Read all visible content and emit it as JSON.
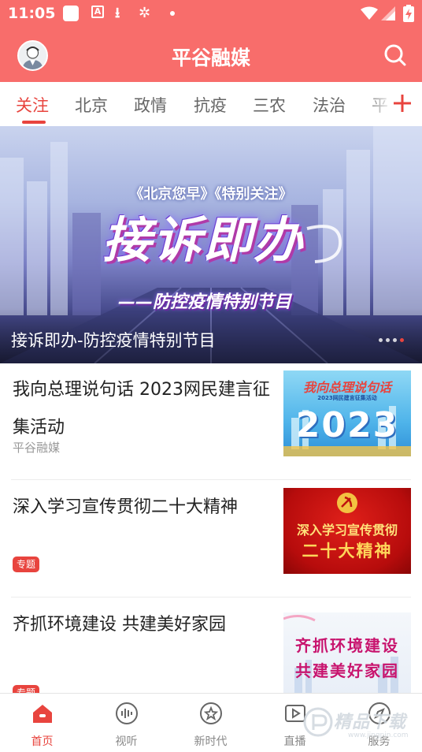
{
  "status_bar": {
    "time": "11:05",
    "icons": [
      "notification-square-icon",
      "a-box-icon",
      "download-icon",
      "bug-icon",
      "dot-icon",
      "wifi-icon",
      "signal-icon",
      "battery-icon"
    ]
  },
  "header": {
    "title": "平谷融媒",
    "brand_color": "#f86d6b"
  },
  "tabs": {
    "items": [
      {
        "label": "关注",
        "active": true
      },
      {
        "label": "北京"
      },
      {
        "label": "政情"
      },
      {
        "label": "抗疫"
      },
      {
        "label": "三农"
      },
      {
        "label": "法治"
      },
      {
        "label": "平"
      }
    ],
    "accent_color": "#e8443e"
  },
  "banner": {
    "image_subtitle": "《北京您早》《特别关注》",
    "image_title": "接诉即办",
    "image_line": "——防控疫情特别节目",
    "caption": "接诉即办-防控疫情特别节目",
    "slide_count": 4,
    "active_slide": 4
  },
  "news": [
    {
      "title": "我向总理说句话 2023网民建言征集活动",
      "source": "平谷融媒",
      "thumb": {
        "line1": "我向总理说句话",
        "line2": "2023网民建言征集活动",
        "big": "2023"
      }
    },
    {
      "title": "深入学习宣传贯彻二十大精神",
      "tag": "专题",
      "thumb": {
        "line1": "深入学习宣传贯彻",
        "line2": "二十大精神"
      }
    },
    {
      "title": "齐抓环境建设 共建美好家园",
      "tag": "专题",
      "thumb": {
        "line1": "齐抓环境建设",
        "line2": "共建美好家园"
      }
    }
  ],
  "bottom_nav": {
    "items": [
      {
        "label": "首页",
        "icon": "home-icon",
        "active": true
      },
      {
        "label": "视听",
        "icon": "audio-wave-icon"
      },
      {
        "label": "新时代",
        "icon": "star-badge-icon"
      },
      {
        "label": "直播",
        "icon": "video-play-icon"
      },
      {
        "label": "服务",
        "icon": "compass-icon"
      }
    ]
  },
  "watermark": {
    "text": "精品下载",
    "sub": "www.jingpin.com"
  }
}
